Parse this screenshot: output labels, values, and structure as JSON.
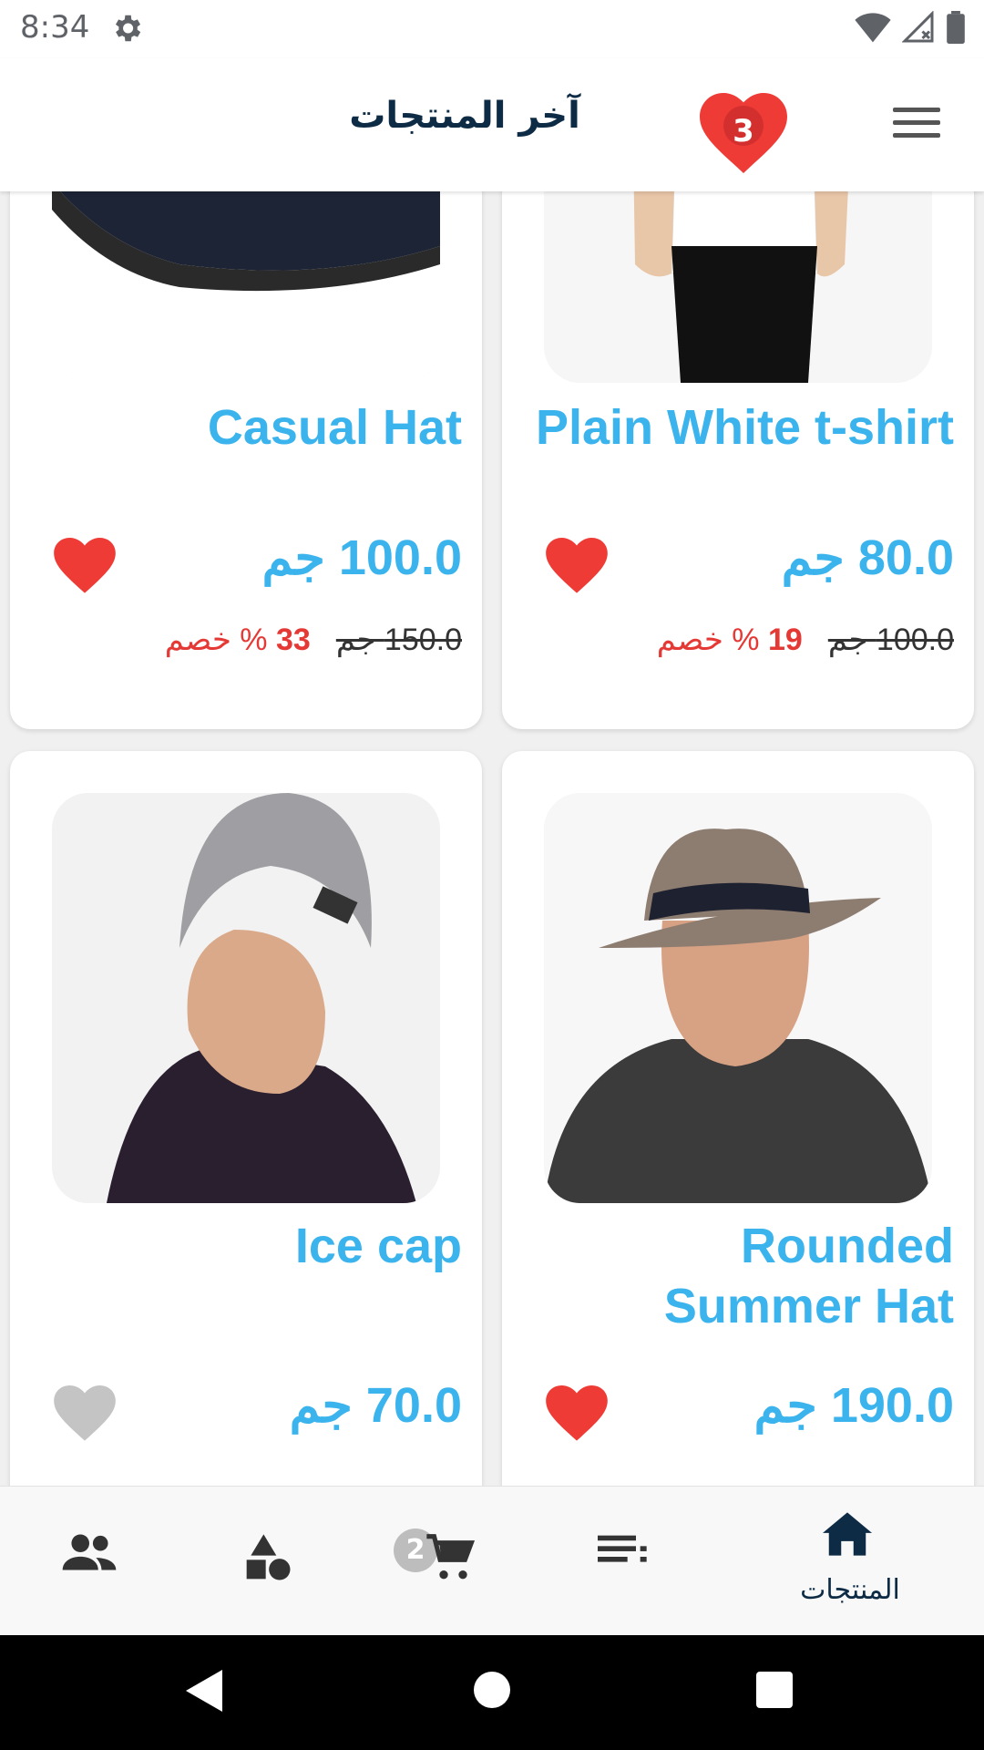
{
  "status": {
    "time": "8:34"
  },
  "app_bar": {
    "title": "آخر المنتجات",
    "favorites_count": "3"
  },
  "products": [
    {
      "name": "Casual Hat",
      "price": "100.0 جم",
      "old_price": "150.0 جم",
      "discount_value": "33",
      "discount_suffix": "% خصم",
      "favorite": true
    },
    {
      "name": "Plain White t-shirt",
      "price": "80.0 جم",
      "old_price": "100.0 جم",
      "discount_value": "19",
      "discount_suffix": "% خصم",
      "favorite": true
    },
    {
      "name": "Ice cap",
      "price": "70.0 جم",
      "favorite": false
    },
    {
      "name": "Rounded Summer Hat",
      "price": "190.0 جم",
      "favorite": true
    }
  ],
  "bottom_nav": {
    "items": [
      {
        "icon": "people-icon"
      },
      {
        "icon": "categories-icon"
      },
      {
        "icon": "cart-icon",
        "badge": "2"
      },
      {
        "icon": "list-icon"
      },
      {
        "icon": "home-icon",
        "label": "المنتجات"
      }
    ]
  },
  "colors": {
    "accent": "#3bb3ec",
    "discount": "#e53935",
    "heart": "#ef3b36",
    "heart_inactive": "#c4c4c4",
    "title": "#0d2b45"
  }
}
